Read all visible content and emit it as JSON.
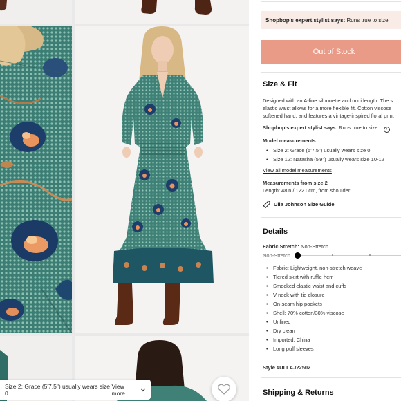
{
  "gallery": {
    "size_note": "Size 2: Grace (5'7.5\") usually wears size 0",
    "view_more_label": "View more"
  },
  "panel": {
    "stylist_banner": {
      "label": "Shopbop's expert stylist says:",
      "value": "Runs true to size."
    },
    "cta_label": "Out of Stock",
    "size_fit": {
      "heading": "Size & Fit",
      "description": [
        "Designed with an A-line silhouette and midi length. The s",
        "elastic waist allows for a more flexible fit. Cotton viscose",
        "softened hand, and features a vintage-inspired floral print"
      ],
      "stylist_label": "Shopbop's expert stylist says:",
      "stylist_value": "Runs true to size.",
      "model_heading": "Model measurements:",
      "models": [
        "Size 2: Grace (5'7.5\") usually wears size 0",
        "Size 12: Natasha (5'9\") usually wears size 10-12"
      ],
      "view_all_link": "View all model measurements",
      "measure_heading": "Measurements from size 2",
      "measure_value": "Length: 48in / 122.0cm, from shoulder",
      "size_guide_link": "Ulla Johnson Size Guide"
    },
    "details": {
      "heading": "Details",
      "stretch_label": "Fabric Stretch:",
      "stretch_value": "Non-Stretch",
      "scale_label": "Non-Stretch",
      "scale_level": 0,
      "items": [
        "Fabric: Lightweight, non-stretch weave",
        "Tiered skirt with ruffle hem",
        "Smocked elastic waist and cuffs",
        "V neck with tie closure",
        "On-seam hip pockets",
        "Shell: 70% cotton/30% viscose",
        "Unlined",
        "Dry clean",
        "Imported, China",
        "Long puff sleeves"
      ],
      "style_label": "Style #ULLAJ22502"
    },
    "shipping_heading": "Shipping & Returns"
  },
  "colors": {
    "cta": "#ea9b88",
    "banner": "#f9ece6",
    "dress_teal": "#2f6d66"
  }
}
